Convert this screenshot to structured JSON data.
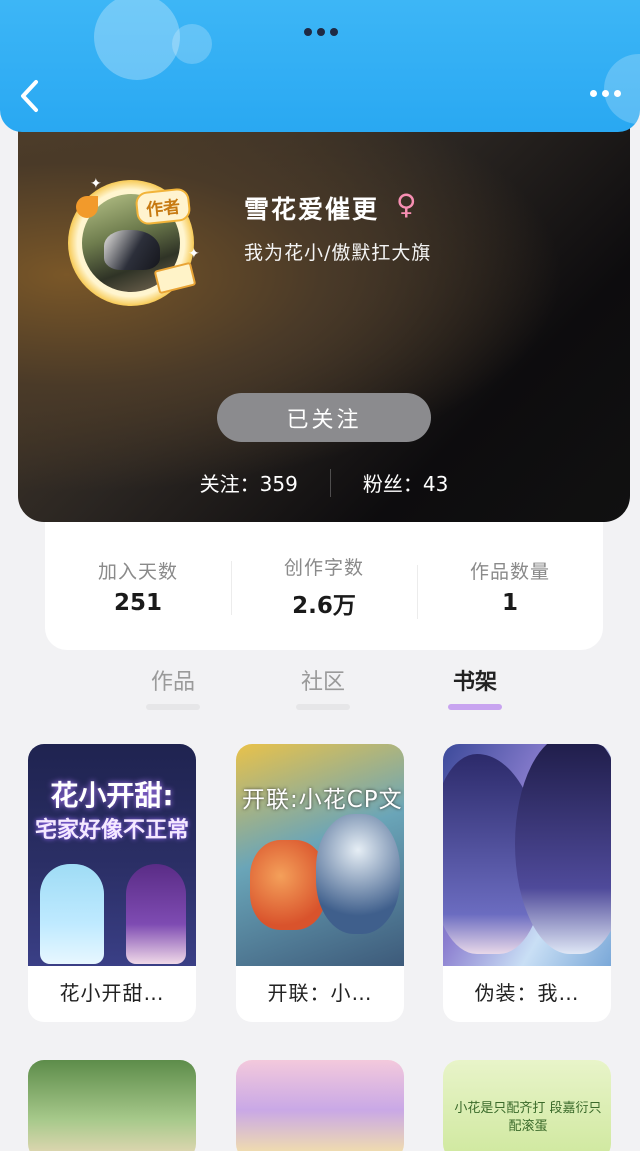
{
  "profile": {
    "username": "雪花爱催更",
    "gender_symbol": "♀",
    "motto": "我为花小/傲默扛大旗",
    "author_badge": "作者",
    "follow_button": "已关注",
    "following_label": "关注：359",
    "followers_label": "粉丝：43"
  },
  "stats": [
    {
      "label": "加入天数",
      "value": "251"
    },
    {
      "label": "创作字数",
      "value": "2.6万"
    },
    {
      "label": "作品数量",
      "value": "1"
    }
  ],
  "tabs": [
    {
      "label": "作品",
      "active": false
    },
    {
      "label": "社区",
      "active": false
    },
    {
      "label": "书架",
      "active": true
    }
  ],
  "books": [
    {
      "title": "花小开甜…",
      "cover_text_1": "花小开甜:",
      "cover_text_2": "宅家好像不正常"
    },
    {
      "title": "开联：小…",
      "cover_text_1": "开联:小花CP文"
    },
    {
      "title": "伪装：我…"
    }
  ],
  "books_row2": [
    {
      "cover_text": "小花是只配齐打 段嘉衍只配滚蛋"
    }
  ],
  "colors": {
    "header": "#2aa9f2",
    "tab_active_bar": "#c8a4f0",
    "follow_button": "#8b8b8e"
  },
  "icons": {
    "back": "chevron-left-icon",
    "more": "more-dots-icon",
    "gender": "female-icon"
  }
}
